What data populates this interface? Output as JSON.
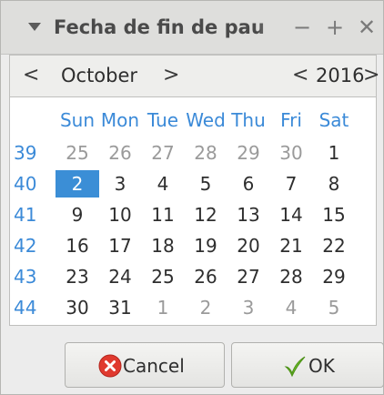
{
  "window": {
    "title": "Fecha de fin de pau",
    "min_glyph": "−",
    "max_glyph": "+",
    "close_glyph": "✕"
  },
  "calendar": {
    "month_prev_glyph": "<",
    "month": "October",
    "month_next_glyph": ">",
    "year_prev_glyph": "<",
    "year": "2016",
    "year_next_glyph": ">",
    "day_names": [
      "Sun",
      "Mon",
      "Tue",
      "Wed",
      "Thu",
      "Fri",
      "Sat"
    ],
    "weeks": [
      {
        "number": "39",
        "days": [
          {
            "d": "25",
            "other": true
          },
          {
            "d": "26",
            "other": true
          },
          {
            "d": "27",
            "other": true
          },
          {
            "d": "28",
            "other": true
          },
          {
            "d": "29",
            "other": true
          },
          {
            "d": "30",
            "other": true
          },
          {
            "d": "1",
            "other": false
          }
        ]
      },
      {
        "number": "40",
        "days": [
          {
            "d": "2",
            "other": false,
            "selected": true
          },
          {
            "d": "3",
            "other": false
          },
          {
            "d": "4",
            "other": false
          },
          {
            "d": "5",
            "other": false
          },
          {
            "d": "6",
            "other": false
          },
          {
            "d": "7",
            "other": false
          },
          {
            "d": "8",
            "other": false
          }
        ]
      },
      {
        "number": "41",
        "days": [
          {
            "d": "9",
            "other": false
          },
          {
            "d": "10",
            "other": false
          },
          {
            "d": "11",
            "other": false
          },
          {
            "d": "12",
            "other": false
          },
          {
            "d": "13",
            "other": false
          },
          {
            "d": "14",
            "other": false
          },
          {
            "d": "15",
            "other": false
          }
        ]
      },
      {
        "number": "42",
        "days": [
          {
            "d": "16",
            "other": false
          },
          {
            "d": "17",
            "other": false
          },
          {
            "d": "18",
            "other": false
          },
          {
            "d": "19",
            "other": false
          },
          {
            "d": "20",
            "other": false
          },
          {
            "d": "21",
            "other": false
          },
          {
            "d": "22",
            "other": false
          }
        ]
      },
      {
        "number": "43",
        "days": [
          {
            "d": "23",
            "other": false
          },
          {
            "d": "24",
            "other": false
          },
          {
            "d": "25",
            "other": false
          },
          {
            "d": "26",
            "other": false
          },
          {
            "d": "27",
            "other": false
          },
          {
            "d": "28",
            "other": false
          },
          {
            "d": "29",
            "other": false
          }
        ]
      },
      {
        "number": "44",
        "days": [
          {
            "d": "30",
            "other": false
          },
          {
            "d": "31",
            "other": false
          },
          {
            "d": "1",
            "other": true
          },
          {
            "d": "2",
            "other": true
          },
          {
            "d": "3",
            "other": true
          },
          {
            "d": "4",
            "other": true
          },
          {
            "d": "5",
            "other": true
          }
        ]
      }
    ]
  },
  "buttons": {
    "cancel_label": "Cancel",
    "cancel_icon": "cancel-icon",
    "ok_label": "OK",
    "ok_icon": "check-icon"
  },
  "colors": {
    "accent": "#3b8ed6",
    "day_name": "#3b8ad8",
    "other_month": "#9a9a9a",
    "cancel_icon": "#e03a2f",
    "ok_icon": "#6fbf2a"
  }
}
